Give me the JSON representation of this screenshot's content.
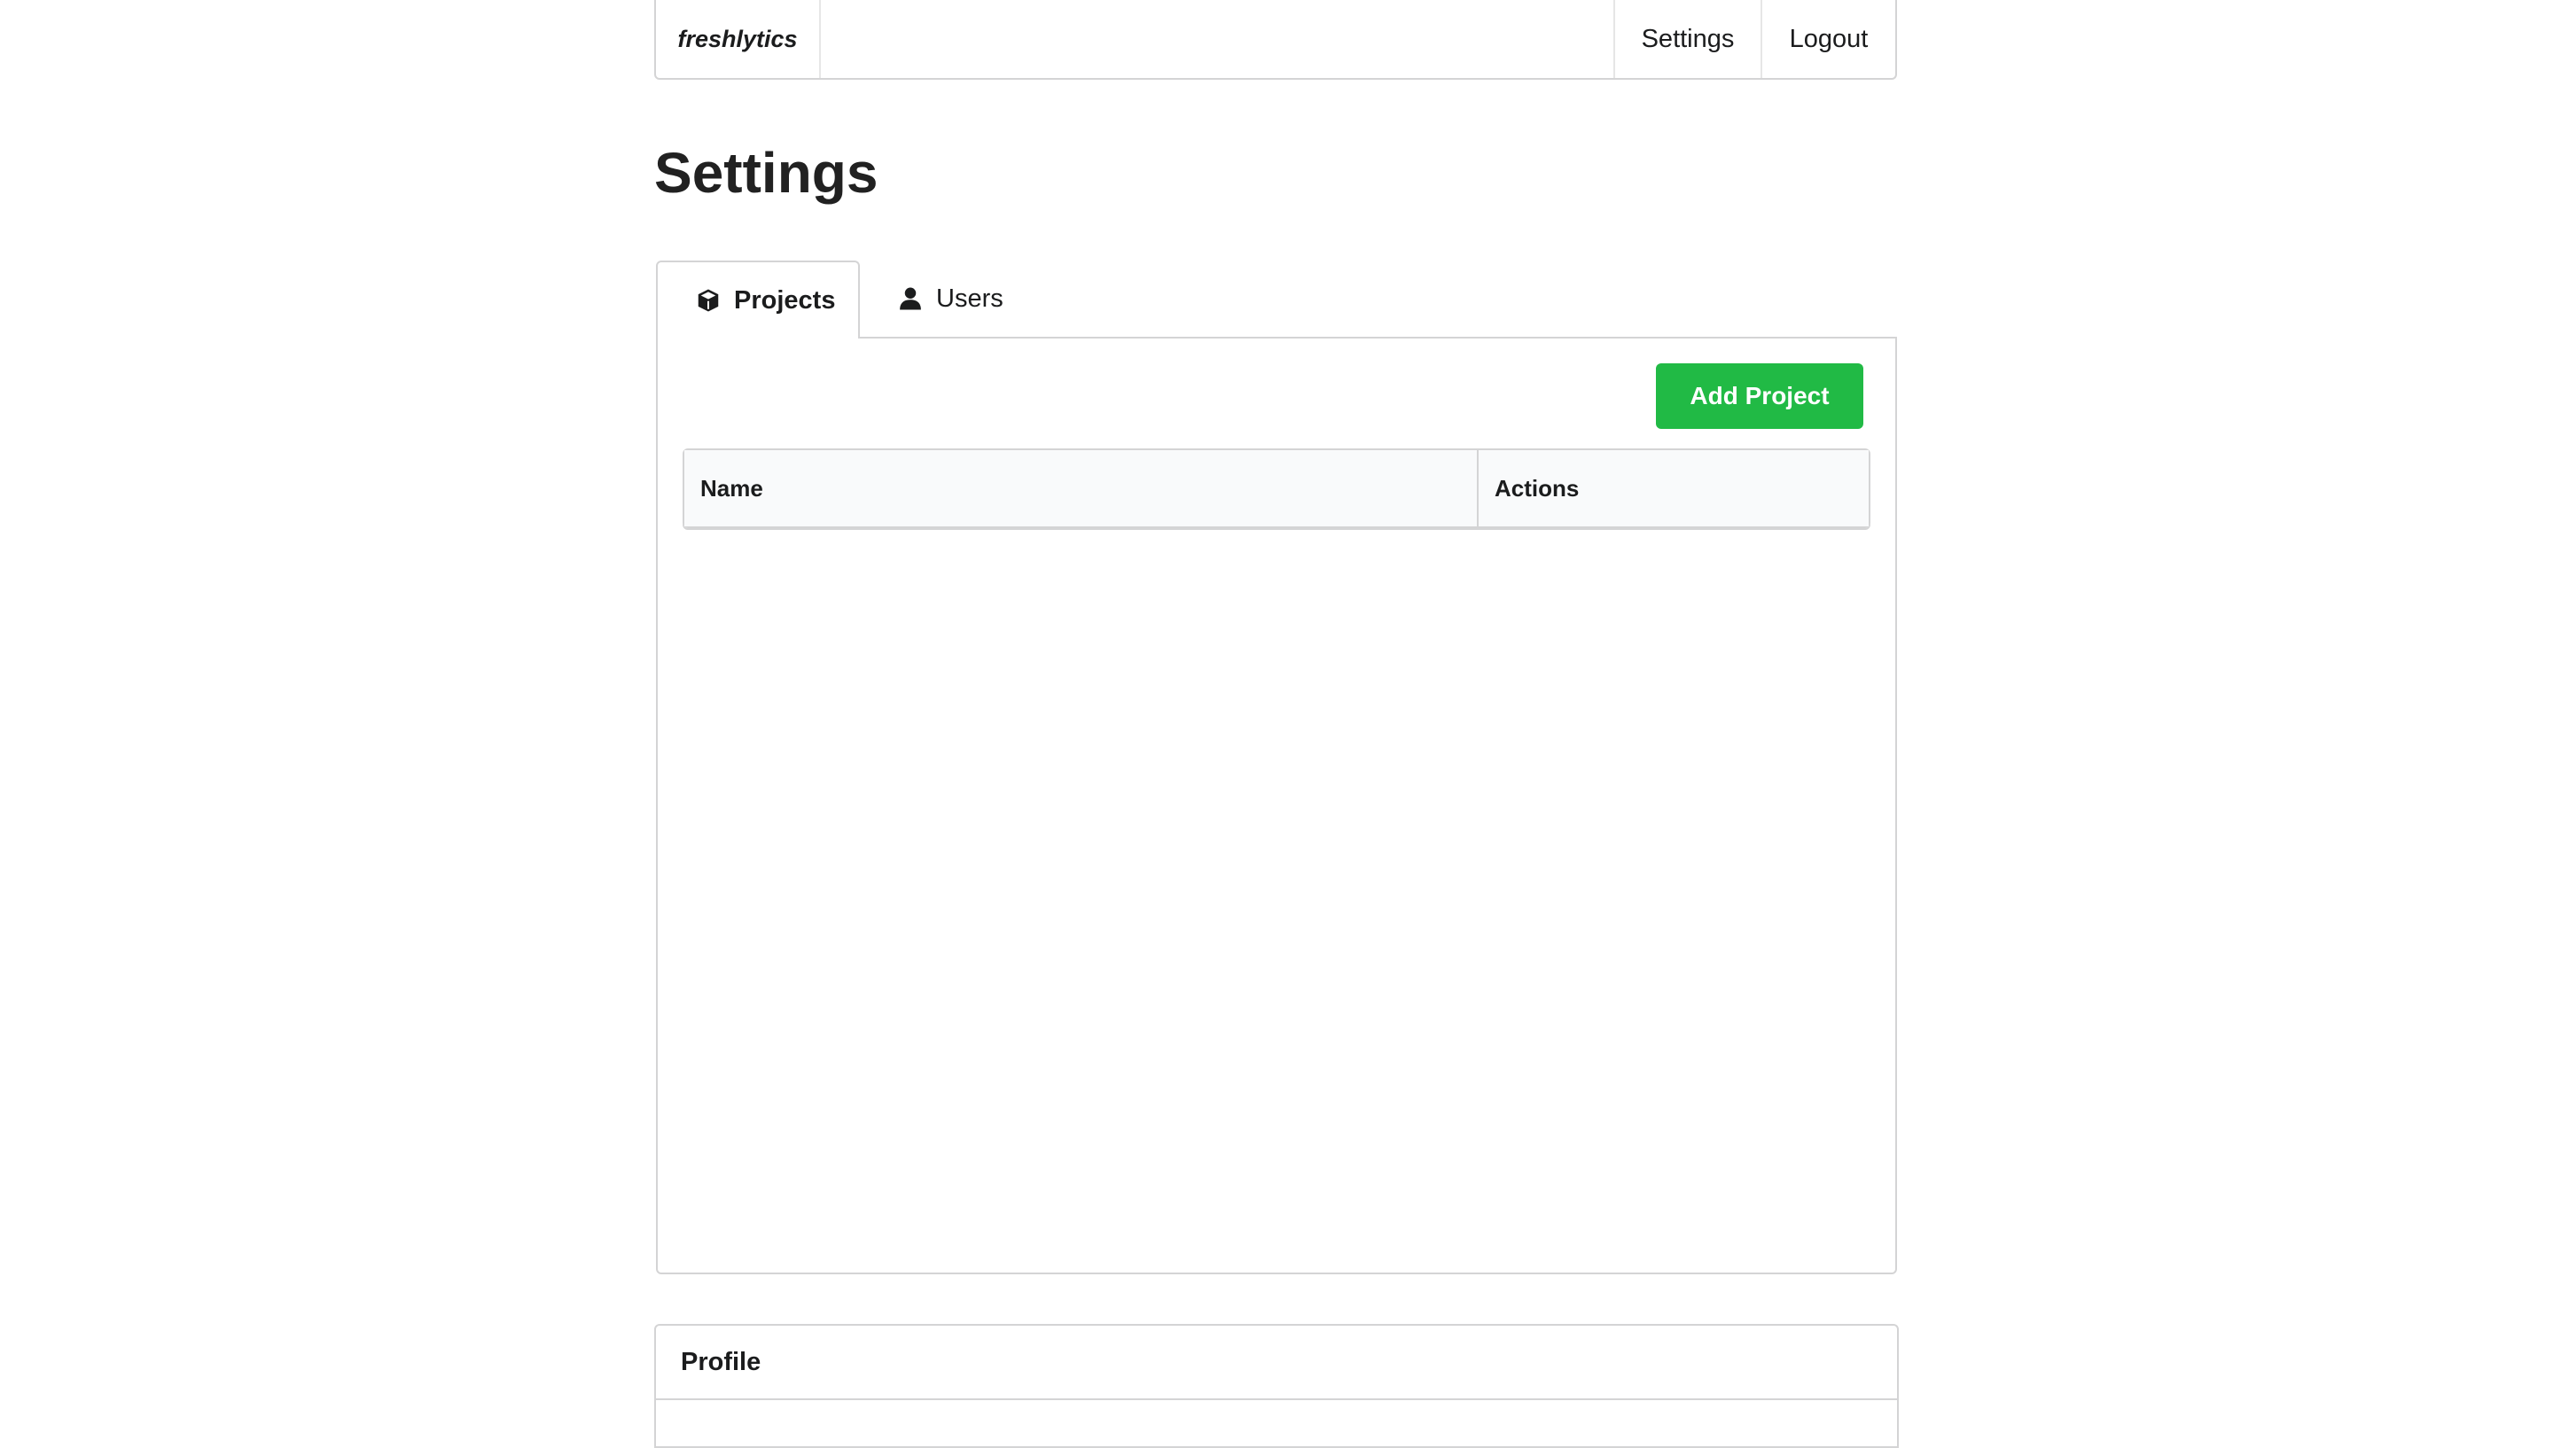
{
  "nav": {
    "brand": "freshlytics",
    "settings_label": "Settings",
    "logout_label": "Logout"
  },
  "page": {
    "title": "Settings"
  },
  "tabs": [
    {
      "label": "Projects",
      "icon": "cube-icon",
      "active": true
    },
    {
      "label": "Users",
      "icon": "user-icon",
      "active": false
    }
  ],
  "projects": {
    "add_label": "Add Project",
    "columns": [
      "Name",
      "Actions"
    ],
    "rows": []
  },
  "profile": {
    "title": "Profile"
  },
  "colors": {
    "accent_green": "#21ba45",
    "border": "#d4d4d5",
    "table_header_bg": "#f9fafb"
  }
}
